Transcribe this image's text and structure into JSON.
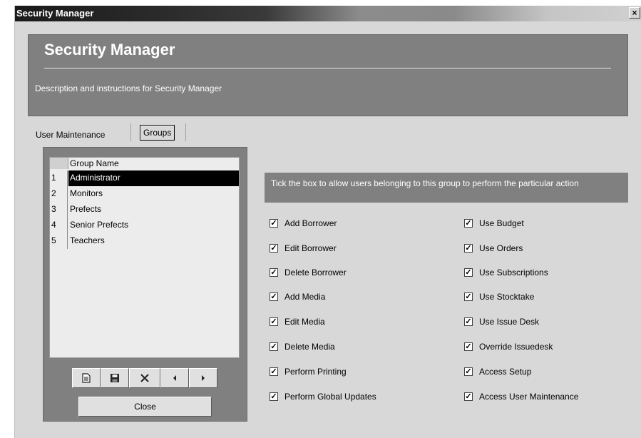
{
  "window": {
    "title": "Security Manager",
    "close_glyph": "×"
  },
  "header": {
    "title": "Security Manager",
    "description": "Description and instructions for Security Manager"
  },
  "tabs": [
    {
      "label": "User Maintenance"
    },
    {
      "label": "Groups",
      "selected": true
    }
  ],
  "groups_grid": {
    "column_header": "Group Name",
    "rows": [
      {
        "num": "1",
        "name": "Administrator",
        "selected": true
      },
      {
        "num": "2",
        "name": "Monitors"
      },
      {
        "num": "3",
        "name": "Prefects"
      },
      {
        "num": "4",
        "name": "Senior Prefects"
      },
      {
        "num": "5",
        "name": "Teachers"
      }
    ]
  },
  "toolbar": {
    "icons": [
      "new-document-icon",
      "save-icon",
      "delete-icon",
      "previous-icon",
      "next-icon"
    ],
    "close_label": "Close"
  },
  "instruction_text": "Tick the box to allow users belonging to this group to perform the particular action",
  "permissions_left": [
    {
      "label": "Add Borrower",
      "checked": true
    },
    {
      "label": "Edit Borrower",
      "checked": true
    },
    {
      "label": "Delete Borrower",
      "checked": true
    },
    {
      "label": "Add Media",
      "checked": true
    },
    {
      "label": "Edit Media",
      "checked": true
    },
    {
      "label": "Delete Media",
      "checked": true
    },
    {
      "label": "Perform Printing",
      "checked": true
    },
    {
      "label": "Perform Global Updates",
      "checked": true
    }
  ],
  "permissions_right": [
    {
      "label": "Use Budget",
      "checked": true
    },
    {
      "label": "Use Orders",
      "checked": true
    },
    {
      "label": "Use Subscriptions",
      "checked": true
    },
    {
      "label": "Use Stocktake",
      "checked": true
    },
    {
      "label": "Use Issue Desk",
      "checked": true
    },
    {
      "label": "Override Issuedesk",
      "checked": true
    },
    {
      "label": "Access Setup",
      "checked": true
    },
    {
      "label": "Access User Maintenance",
      "checked": true
    }
  ],
  "colors": {
    "panel_gray": "#808080",
    "window_bg": "#d8d8d8",
    "selected_row": "#000000"
  }
}
